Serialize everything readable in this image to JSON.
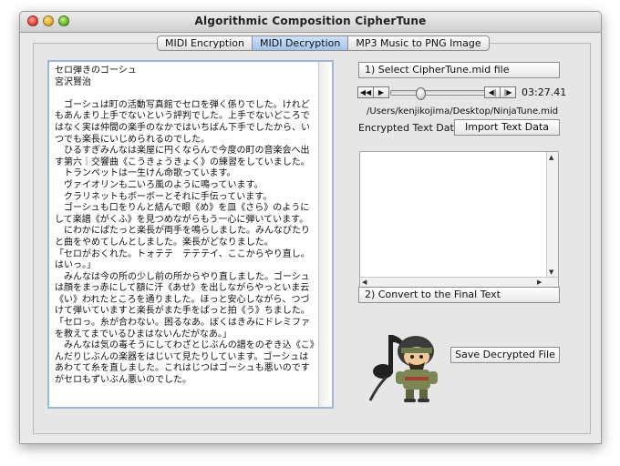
{
  "window": {
    "title": "Algorithmic Composition CipherTune"
  },
  "tabs": [
    {
      "label": "MIDI Encryption"
    },
    {
      "label": "MIDI Decryption"
    },
    {
      "label": "MP3 Music to PNG Image"
    }
  ],
  "active_tab_index": 1,
  "text_panel": {
    "content": "セロ弾きのゴーシュ\n宮沢賢治\n\n　ゴーシュは町の活動写真館でセロを弾く係りでした。けれどもあんまり上手でないという評判でした。上手でないどころではなく実は仲間の楽手のなかではいちばん下手でしたから、いつでも楽長にいじめられるのでした。\n　ひるすぎみんなは楽屋に円くならんで今度の町の音楽会へ出す第六｜交響曲《こうきょうきょく》の練習をしていました。\n　トランペットは一生けん命歌っています。\n　ヴァイオリンも二いろ風のように鳴っています。\n　クラリネットもボーボーとそれに手伝っています。\n　ゴーシュも口をりんと結んで眼《め》を皿《さら》のようにして楽譜《がくふ》を見つめながらもう一心に弾いています。\n　にわかにぱたっと楽長が両手を鳴らしました。みんなぴたりと曲をやめてしんとしました。楽長がどなりました。\n「セロがおくれた。トォテテ　テテテイ、ここからやり直し。はいっ。」\n　みんなは今の所の少し前の所からやり直しました。ゴーシュは顔をまっ赤にして額に汗《あせ》を出しながらやっといま云《い》われたところを通りました。ほっと安心しながら、つづけて弾いていますと楽長がまた手をぱっと拍《う》ちました。\n「セロっ。糸が合わない。困るなあ。ぼくはきみにドレミファを教えてまでいるひまはないんだがなあ。」\n　みんなは気の毒そうにしてわざとじぶんの譜をのぞき込《こ》んだりじぶんの楽器をはじいて見たりしています。ゴーシュはあわてて糸を直しました。これはじつはゴーシュも悪いのですがセロもずいぶん悪いのでした。"
  },
  "select_button": {
    "label": "1) Select CipherTune.mid file"
  },
  "player": {
    "time": "03:27.41",
    "file_path": "/Users/kenjikojima/Desktop/NinjaTune.mid",
    "position_fraction": 0.28,
    "buttons": [
      "rewind-volume",
      "play",
      "prev",
      "next"
    ]
  },
  "encrypted": {
    "label": "Encrypted Text Data.",
    "import_button": "Import Text Data",
    "value": ""
  },
  "convert_button": {
    "label": "2) Convert to the Final Text"
  },
  "save_button": {
    "label": "Save Decrypted File"
  },
  "colors": {
    "active_tab": "#a9c9ee",
    "text_border": "#9bb7da",
    "window_bg": "#e9e9e9"
  }
}
